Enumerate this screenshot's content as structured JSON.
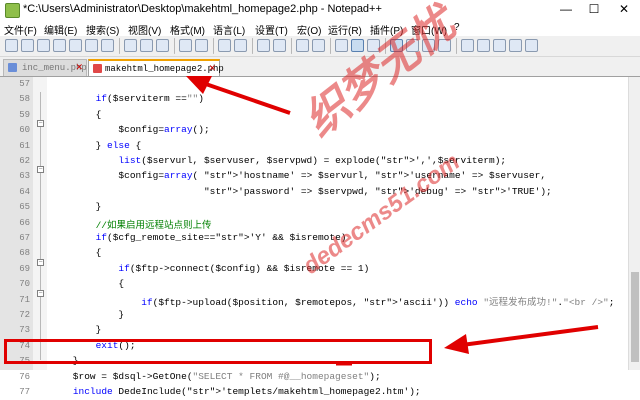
{
  "window": {
    "title": "*C:\\Users\\Administrator\\Desktop\\makehtml_homepage2.php - Notepad++",
    "minimize": "—",
    "maximize": "☐",
    "close": "✕"
  },
  "menu": [
    "文件(F)",
    "编辑(E)",
    "搜索(S)",
    "视图(V)",
    "格式(M)",
    "语言(L)",
    "设置(T)",
    "宏(O)",
    "运行(R)",
    "插件(P)",
    "窗口(W)",
    "?"
  ],
  "tabs": [
    {
      "label": "inc_menu.php",
      "close": "✕",
      "active": false
    },
    {
      "label": "makehtml_homepage2.php",
      "close": "✕",
      "active": true
    }
  ],
  "code_lines": [
    {
      "n": "57",
      "text": ""
    },
    {
      "n": "58",
      "text": "        if($serviterm ==\"\")"
    },
    {
      "n": "59",
      "text": "        {"
    },
    {
      "n": "60",
      "text": "            $config=array();"
    },
    {
      "n": "61",
      "text": "        } else {"
    },
    {
      "n": "62",
      "text": "            list($servurl, $servuser, $servpwd) = explode(',',$serviterm);"
    },
    {
      "n": "63",
      "text": "            $config=array( 'hostname' => $servurl, 'username' => $servuser,"
    },
    {
      "n": "64",
      "text": "                           'password' => $servpwd, 'debug' => 'TRUE');"
    },
    {
      "n": "65",
      "text": "        }"
    },
    {
      "n": "66",
      "text": "        //如果启用远程站点则上传"
    },
    {
      "n": "67",
      "text": "        if($cfg_remote_site=='Y' && $isremote)"
    },
    {
      "n": "68",
      "text": "        {"
    },
    {
      "n": "69",
      "text": "            if($ftp->connect($config) && $isremote == 1)"
    },
    {
      "n": "70",
      "text": "            {"
    },
    {
      "n": "71",
      "text": "                if($ftp->upload($position, $remotepos, 'ascii')) echo \"远程发布成功!\".\"<br />\";"
    },
    {
      "n": "72",
      "text": "            }"
    },
    {
      "n": "73",
      "text": "        }"
    },
    {
      "n": "74",
      "text": "        exit();"
    },
    {
      "n": "75",
      "text": "    }"
    },
    {
      "n": "76",
      "text": "    $row = $dsql->GetOne(\"SELECT * FROM #@__homepageset\");"
    },
    {
      "n": "77",
      "text": "    include DedeInclude('templets/makehtml_homepage2.htm');"
    }
  ],
  "watermark": {
    "main": "织梦无忧",
    "url": "dedecms51.com"
  },
  "colors": {
    "annotation": "#e00000",
    "keyword": "#0000ff",
    "string": "#808080",
    "comment": "#008000"
  }
}
